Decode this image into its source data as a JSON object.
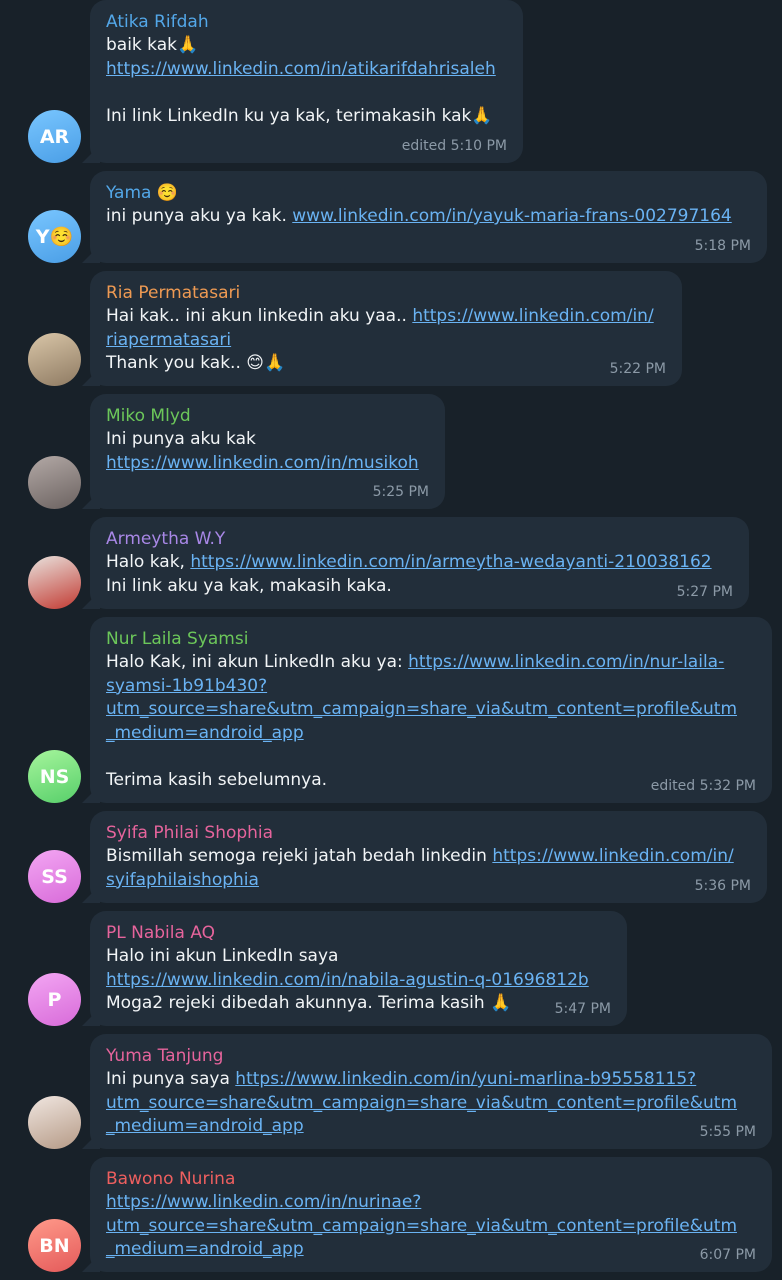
{
  "colors": {
    "background": "#182129",
    "bubble": "#222e3a",
    "link": "#6ab3f3",
    "meta": "#8c9aa7"
  },
  "messages": [
    {
      "sender": "Atika Rifdah",
      "sender_color": "#53a7e8",
      "avatar": {
        "initials": "AR",
        "gradient": [
          "#79c6ff",
          "#4a9ee6"
        ]
      },
      "lines": [
        [
          {
            "t": "baik kak🙏"
          }
        ],
        [
          {
            "t": "https://www.linkedin.com/in/atikarifdahrisaleh",
            "link": true
          }
        ],
        [],
        [
          {
            "t": "Ini link LinkedIn ku ya kak, terimakasih kak🙏"
          }
        ]
      ],
      "meta": "edited 5:10 PM"
    },
    {
      "sender": "Yama ☺️",
      "sender_color": "#53a7e8",
      "avatar": {
        "initials": "Y☺️",
        "gradient": [
          "#79c6ff",
          "#4a9ee6"
        ]
      },
      "lines": [
        [
          {
            "t": "ini punya aku ya kak. "
          },
          {
            "t": "www.linkedin.com/in/yayuk-maria-frans-002797164",
            "link": true
          }
        ]
      ],
      "meta": "5:18 PM"
    },
    {
      "sender": "Ria Permatasari",
      "sender_color": "#ee9a53",
      "avatar": {
        "photo": "photo-hijab",
        "gradient": [
          "#d9c6a8",
          "#8e7a62"
        ]
      },
      "lines": [
        [
          {
            "t": "Hai kak.. ini akun linkedin aku yaa.. "
          },
          {
            "t": "https://www.linkedin.com/in/",
            "link": true
          }
        ],
        [
          {
            "t": "riapermatasari",
            "link": true
          }
        ],
        [
          {
            "t": "Thank you kak.. 😊🙏"
          }
        ]
      ],
      "meta": "5:22 PM"
    },
    {
      "sender": "Miko Mlyd",
      "sender_color": "#6cc75a",
      "avatar": {
        "photo": "photo-blurred",
        "gradient": [
          "#b3a9a6",
          "#6b6260"
        ]
      },
      "lines": [
        [
          {
            "t": "Ini punya aku kak"
          }
        ],
        [
          {
            "t": "https://www.linkedin.com/in/musikoh",
            "link": true
          }
        ]
      ],
      "meta": "5:25 PM"
    },
    {
      "sender": "Armeytha W.Y",
      "sender_color": "#a887e6",
      "avatar": {
        "photo": "photo-red-shirt",
        "gradient": [
          "#e9e3de",
          "#c23a32"
        ]
      },
      "lines": [
        [
          {
            "t": "Halo kak, "
          },
          {
            "t": "https://www.linkedin.com/in/armeytha-wedayanti-210038162",
            "link": true
          }
        ],
        [
          {
            "t": "Ini link aku ya kak, makasih kaka."
          }
        ]
      ],
      "meta": "5:27 PM"
    },
    {
      "sender": "Nur Laila Syamsi",
      "sender_color": "#6cc75a",
      "avatar": {
        "initials": "NS",
        "gradient": [
          "#a6f59c",
          "#57cf6a"
        ]
      },
      "lines": [
        [
          {
            "t": "Halo Kak, ini akun LinkedIn aku ya: "
          },
          {
            "t": "https://www.linkedin.com/in/nur-laila-",
            "link": true
          }
        ],
        [
          {
            "t": "syamsi-1b91b430?",
            "link": true
          }
        ],
        [
          {
            "t": "utm_source=share&utm_campaign=share_via&utm_content=profile&utm",
            "link": true
          }
        ],
        [
          {
            "t": "_medium=android_app",
            "link": true
          }
        ],
        [],
        [
          {
            "t": "Terima kasih sebelumnya."
          }
        ]
      ],
      "meta": "edited 5:32 PM"
    },
    {
      "sender": "Syifa Philai Shophia",
      "sender_color": "#e6649c",
      "avatar": {
        "initials": "SS",
        "gradient": [
          "#f3a6f3",
          "#d86bd9"
        ]
      },
      "lines": [
        [
          {
            "t": "Bismillah semoga rejeki jatah bedah linkedin "
          },
          {
            "t": "https://www.linkedin.com/in/",
            "link": true
          }
        ],
        [
          {
            "t": "syifaphilaishophia",
            "link": true
          }
        ]
      ],
      "meta": "5:36 PM"
    },
    {
      "sender": "PL Nabila AQ",
      "sender_color": "#e6649c",
      "avatar": {
        "initials": "P",
        "gradient": [
          "#f3a6f3",
          "#d86bd9"
        ]
      },
      "lines": [
        [
          {
            "t": "Halo ini akun LinkedIn saya"
          }
        ],
        [
          {
            "t": "https://www.linkedin.com/in/nabila-agustin-q-01696812b",
            "link": true
          }
        ],
        [
          {
            "t": "Moga2 rejeki dibedah akunnya. Terima kasih 🙏"
          }
        ]
      ],
      "meta": "5:47 PM"
    },
    {
      "sender": "Yuma Tanjung",
      "sender_color": "#e6649c",
      "avatar": {
        "photo": "photo-portrait",
        "gradient": [
          "#f0e6e0",
          "#b59a86"
        ]
      },
      "lines": [
        [
          {
            "t": "Ini punya saya "
          },
          {
            "t": "https://www.linkedin.com/in/yuni-marlina-b95558115?",
            "link": true
          }
        ],
        [
          {
            "t": "utm_source=share&utm_campaign=share_via&utm_content=profile&utm",
            "link": true
          }
        ],
        [
          {
            "t": "_medium=android_app",
            "link": true
          }
        ]
      ],
      "meta": "5:55 PM"
    },
    {
      "sender": "Bawono Nurina",
      "sender_color": "#ee5f5f",
      "avatar": {
        "initials": "BN",
        "gradient": [
          "#ff9a8a",
          "#e45a5a"
        ]
      },
      "lines": [
        [
          {
            "t": "https://www.linkedin.com/in/nurinae?",
            "link": true
          }
        ],
        [
          {
            "t": "utm_source=share&utm_campaign=share_via&utm_content=profile&utm",
            "link": true
          }
        ],
        [
          {
            "t": "_medium=android_app",
            "link": true
          }
        ]
      ],
      "meta": "6:07 PM"
    }
  ]
}
